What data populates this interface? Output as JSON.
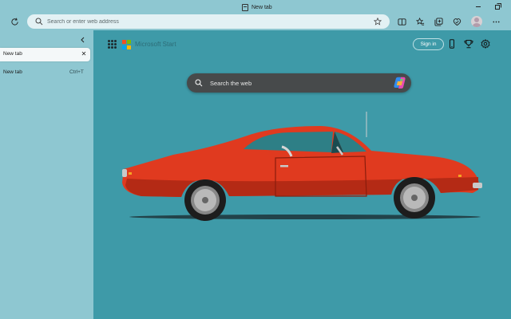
{
  "window": {
    "title": "New tab",
    "colors": {
      "frame": "#8ec7d1",
      "content": "#3e9aa8",
      "car_body": "#e03a1f"
    }
  },
  "toolbar": {
    "address_placeholder": "Search or enter web address",
    "icons": [
      "refresh-icon",
      "search-icon",
      "favorite-star-icon",
      "split-screen-icon",
      "favorites-icon",
      "collections-icon",
      "browser-essentials-icon",
      "profile-avatar",
      "more-icon"
    ]
  },
  "sidebar": {
    "tabs": [
      {
        "label": "New tab",
        "active": true
      }
    ],
    "new_tab": {
      "label": "New tab",
      "shortcut": "Ctrl+T"
    }
  },
  "newtab_page": {
    "brand": "Microsoft Start",
    "signin_label": "Sign in",
    "search_placeholder": "Search the web",
    "background_image": "red classic muscle car on teal background"
  }
}
